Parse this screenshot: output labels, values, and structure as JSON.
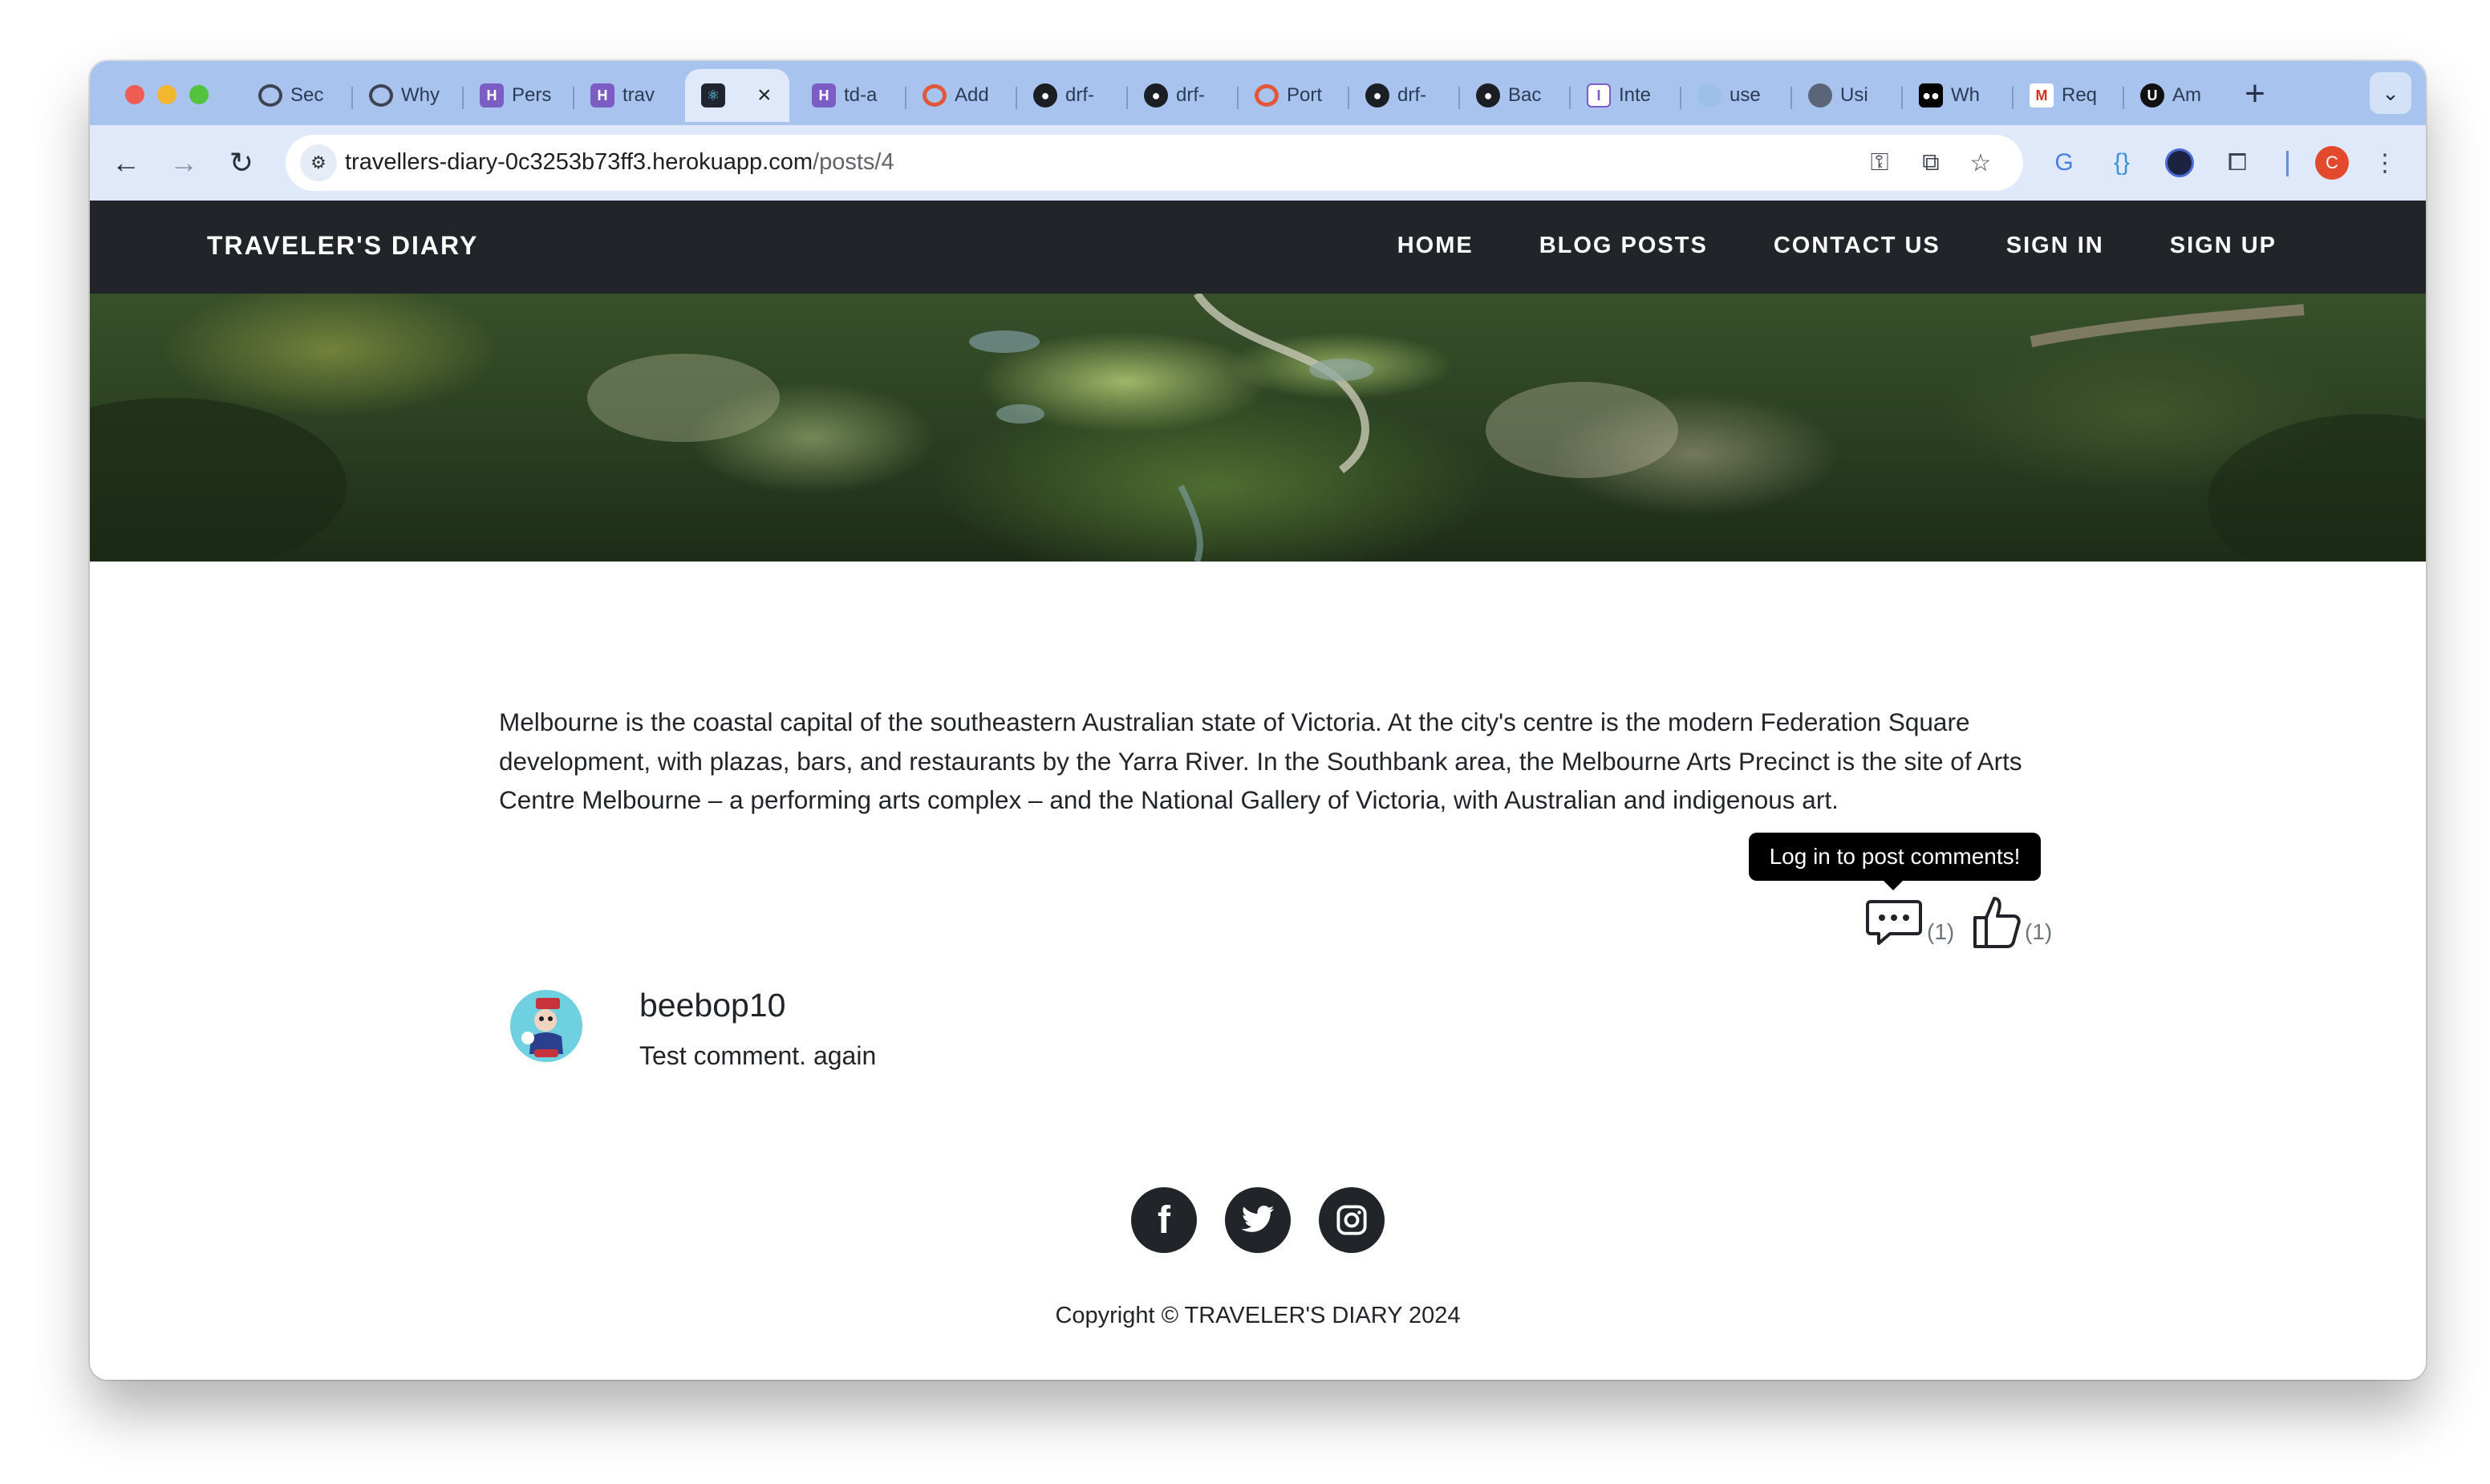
{
  "browser": {
    "tabs": [
      {
        "title": "Sec",
        "icon": "openai-icon"
      },
      {
        "title": "Why",
        "icon": "openai-icon"
      },
      {
        "title": "Pers",
        "icon": "heroku-icon"
      },
      {
        "title": "trav",
        "icon": "heroku-icon"
      },
      {
        "title": "",
        "icon": "react-icon",
        "active": true
      },
      {
        "title": "td-a",
        "icon": "heroku-icon"
      },
      {
        "title": "Add",
        "icon": "ring-icon"
      },
      {
        "title": "drf-",
        "icon": "github-icon"
      },
      {
        "title": "drf-",
        "icon": "github-icon"
      },
      {
        "title": "Port",
        "icon": "ring-icon"
      },
      {
        "title": "drf-",
        "icon": "github-icon"
      },
      {
        "title": "Bac",
        "icon": "github-icon"
      },
      {
        "title": "Inte",
        "icon": "extension-icon"
      },
      {
        "title": "use",
        "icon": "site-icon"
      },
      {
        "title": "Usi",
        "icon": "globe-icon"
      },
      {
        "title": "Wh",
        "icon": "medium-icon"
      },
      {
        "title": "Req",
        "icon": "gmail-icon"
      },
      {
        "title": "Am",
        "icon": "ub-icon"
      }
    ],
    "url": {
      "host": "travellers-diary-0c3253b73ff3.herokuapp.com",
      "path": "/posts/4"
    },
    "profile_initial": "C"
  },
  "site": {
    "brand": "TRAVELER'S DIARY",
    "nav": {
      "home": "HOME",
      "blog_posts": "BLOG POSTS",
      "contact_us": "CONTACT US",
      "sign_in": "SIGN IN",
      "sign_up": "SIGN UP"
    }
  },
  "post": {
    "body": "Melbourne is the coastal capital of the southeastern Australian state of Victoria. At the city's centre is the modern Federation Square development, with plazas, bars, and restaurants by the Yarra River. In the Southbank area, the Melbourne Arts Precinct is the site of Arts Centre Melbourne – a performing arts complex – and the National Gallery of Victoria, with Australian and indigenous art.",
    "tooltip": "Log in to post comments!",
    "comment_count": "(1)",
    "like_count": "(1)"
  },
  "comments": [
    {
      "author": "beebop10",
      "text": "Test comment. again"
    }
  ],
  "footer": {
    "social": [
      "facebook-icon",
      "twitter-icon",
      "instagram-icon"
    ],
    "copyright": "Copyright © TRAVELER'S DIARY 2024"
  }
}
